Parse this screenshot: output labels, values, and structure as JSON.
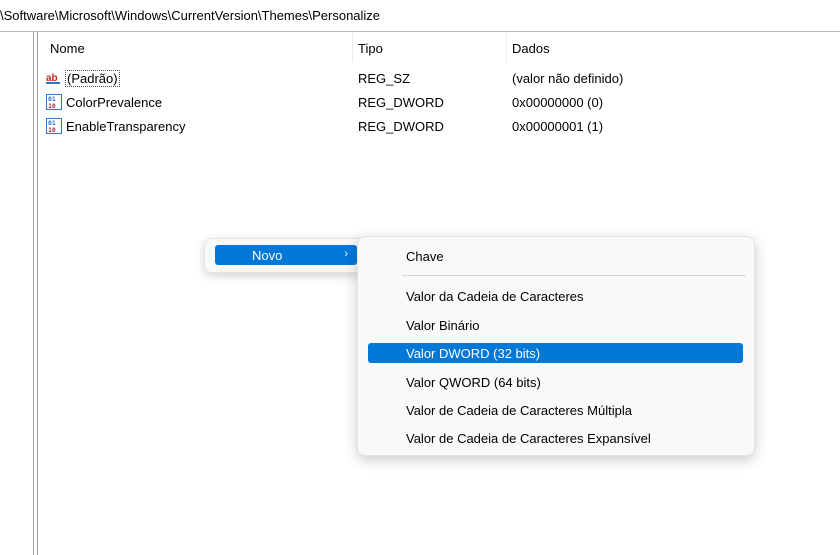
{
  "address_path": "\\Software\\Microsoft\\Windows\\CurrentVersion\\Themes\\Personalize",
  "columns": {
    "name": "Nome",
    "type": "Tipo",
    "data": "Dados"
  },
  "rows": [
    {
      "icon": "string-value-icon",
      "name": "(Padrão)",
      "type": "REG_SZ",
      "data": "(valor não definido)"
    },
    {
      "icon": "binary-value-icon",
      "name": "ColorPrevalence",
      "type": "REG_DWORD",
      "data": "0x00000000 (0)"
    },
    {
      "icon": "binary-value-icon",
      "name": "EnableTransparency",
      "type": "REG_DWORD",
      "data": "0x00000001 (1)"
    }
  ],
  "context_menu": {
    "item": "Novo",
    "arrow": "›"
  },
  "submenu": {
    "items": [
      "Chave",
      "Valor da Cadeia de Caracteres",
      "Valor Binário",
      "Valor DWORD (32 bits)",
      "Valor QWORD (64 bits)",
      "Valor de Cadeia de Caracteres Múltipla",
      "Valor de Cadeia de Caracteres Expansível"
    ],
    "highlighted": "Valor DWORD (32 bits)"
  },
  "colors": {
    "highlight": "#0078d7",
    "menu_bg": "#f9f9f9"
  }
}
